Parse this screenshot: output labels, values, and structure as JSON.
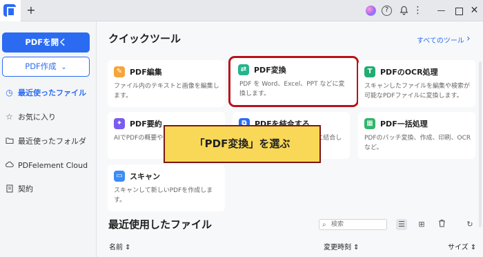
{
  "window": {
    "icons": [
      "app-logo-icon",
      "add-tab-icon",
      "avatar-icon",
      "help-icon",
      "bell-icon",
      "more-icon",
      "minimize-icon",
      "maximize-icon",
      "close-icon"
    ],
    "add_tab": "+",
    "help": "?",
    "more": "⋮",
    "min": "—",
    "close": "✕"
  },
  "sidebar": {
    "open_button": "PDFを開く",
    "create_button": "PDF作成",
    "create_caret": "⌄",
    "items": [
      {
        "label": "最近使ったファイル",
        "icon": "clock-icon",
        "glyph": "◷",
        "active": true
      },
      {
        "label": "お気に入り",
        "icon": "star-icon",
        "glyph": "☆",
        "active": false
      },
      {
        "label": "最近使ったフォルダ",
        "icon": "folder-icon",
        "glyph": "🗀",
        "active": false
      },
      {
        "label": "PDFelement Cloud",
        "icon": "cloud-icon",
        "glyph": "☁",
        "active": false
      },
      {
        "label": "契約",
        "icon": "contract-icon",
        "glyph": "▤",
        "active": false
      }
    ]
  },
  "main": {
    "quick_tools_title": "クイックツール",
    "all_tools_link": "すべてのツール",
    "all_tools_arrow": "›",
    "cards": [
      {
        "title": "PDF編集",
        "desc": "ファイル内のテキストと画像を編集します。",
        "icon": "edit-icon",
        "glyph": "✎",
        "color": "#f6a53a"
      },
      {
        "title": "PDF変換",
        "desc": "PDF を Word、Excel、PPT などに変換します。",
        "icon": "convert-icon",
        "glyph": "⇄",
        "color": "#25b58d"
      },
      {
        "title": "PDFのOCR処理",
        "desc": "スキャンしたファイルを編集や検索が可能なPDFファイルに変換します。",
        "icon": "ocr-icon",
        "glyph": "T",
        "color": "#1fae6f"
      },
      {
        "title": "PDF要約",
        "desc": "AIでPDFの概要や要約を生成します。",
        "icon": "summary-icon",
        "glyph": "✦",
        "color": "#7a5cf0"
      },
      {
        "title": "PDFを結合する",
        "desc": "複数のファイルを1つのPDFに結合します。",
        "icon": "merge-icon",
        "glyph": "⧉",
        "color": "#2a6bf2"
      },
      {
        "title": "PDF一括処理",
        "desc": "PDFのバッチ変換、作成、印刷、OCRなど。",
        "icon": "batch-icon",
        "glyph": "▦",
        "color": "#2fb66a"
      },
      {
        "title": "スキャン",
        "desc": "スキャンして新しいPDFを作成します。",
        "icon": "scan-icon",
        "glyph": "▭",
        "color": "#3a8df5"
      }
    ],
    "callout": "「PDF変換」を選ぶ",
    "recent_title": "最近使用したファイル",
    "search_placeholder": "検索",
    "search_icon": "⌕",
    "view_icons": {
      "list": "☰",
      "grid": "⊞",
      "delete": "🗑",
      "refresh": "↻"
    },
    "columns": {
      "name": "名前 ⇕",
      "modified": "変更時刻 ⇕",
      "size": "サイズ ⇕"
    }
  }
}
